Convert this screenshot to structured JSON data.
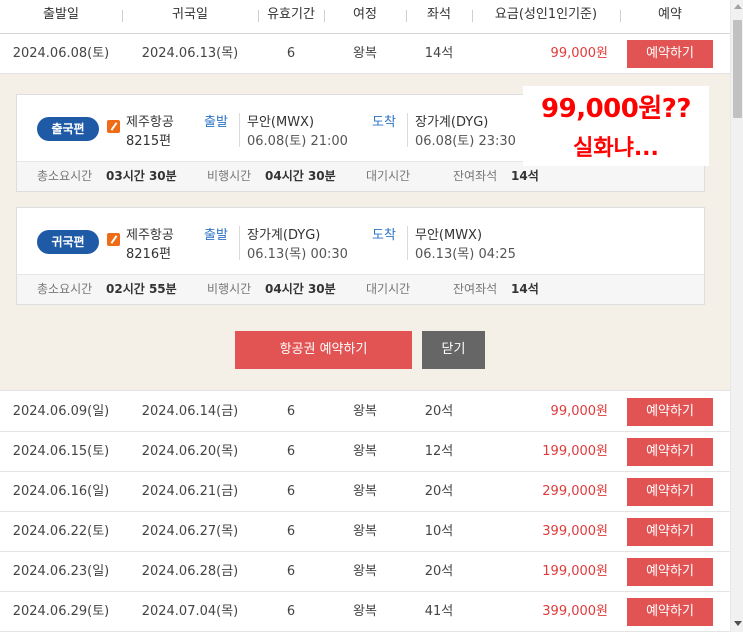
{
  "header": {
    "columns": [
      "출발일",
      "귀국일",
      "유효기간",
      "여정",
      "좌석",
      "요금(성인1인기준)",
      "예약"
    ]
  },
  "book_label": "예약하기",
  "selected_row": {
    "dep": "2024.06.08(토)",
    "ret": "2024.06.13(목)",
    "valid": "6",
    "trip": "왕복",
    "seats": "14석",
    "price": "99,000원"
  },
  "rows": [
    {
      "dep": "2024.06.09(일)",
      "ret": "2024.06.14(금)",
      "valid": "6",
      "trip": "왕복",
      "seats": "20석",
      "price": "99,000원"
    },
    {
      "dep": "2024.06.15(토)",
      "ret": "2024.06.20(목)",
      "valid": "6",
      "trip": "왕복",
      "seats": "12석",
      "price": "199,000원"
    },
    {
      "dep": "2024.06.16(일)",
      "ret": "2024.06.21(금)",
      "valid": "6",
      "trip": "왕복",
      "seats": "20석",
      "price": "299,000원"
    },
    {
      "dep": "2024.06.22(토)",
      "ret": "2024.06.27(목)",
      "valid": "6",
      "trip": "왕복",
      "seats": "10석",
      "price": "399,000원"
    },
    {
      "dep": "2024.06.23(일)",
      "ret": "2024.06.28(금)",
      "valid": "6",
      "trip": "왕복",
      "seats": "20석",
      "price": "199,000원"
    },
    {
      "dep": "2024.06.29(토)",
      "ret": "2024.07.04(목)",
      "valid": "6",
      "trip": "왕복",
      "seats": "41석",
      "price": "399,000원"
    }
  ],
  "detail": {
    "outbound": {
      "badge": "출국편",
      "airline": "제주항공",
      "flight_no": "8215편",
      "dep_label": "출발",
      "dep_place": "무안(MWX)",
      "dep_time": "06.08(토) 21:00",
      "arr_label": "도착",
      "arr_place": "장가계(DYG)",
      "arr_time": "06.08(토) 23:30",
      "total_label": "총소요시간",
      "total_value": "03시간 30분",
      "fly_label": "비행시간",
      "fly_value": "04시간 30분",
      "wait_label": "대기시간",
      "seats_label": "잔여좌석",
      "seats_value": "14석"
    },
    "inbound": {
      "badge": "귀국편",
      "airline": "제주항공",
      "flight_no": "8216편",
      "dep_label": "출발",
      "dep_place": "장가계(DYG)",
      "dep_time": "06.13(목) 00:30",
      "arr_label": "도착",
      "arr_place": "무안(MWX)",
      "arr_time": "06.13(목) 04:25",
      "total_label": "총소요시간",
      "total_value": "02시간 55분",
      "fly_label": "비행시간",
      "fly_value": "04시간 30분",
      "wait_label": "대기시간",
      "seats_label": "잔여좌석",
      "seats_value": "14석"
    },
    "book_ticket_label": "항공권 예약하기",
    "close_label": "닫기"
  },
  "overlay": {
    "line1": "99,000원??",
    "line2": "실화냐..."
  },
  "colors": {
    "accent_red": "#e25454",
    "price_red": "#e03b3b",
    "badge_blue": "#1f5aa6",
    "link_blue": "#2b73c4",
    "panel_bg": "#f4efe7",
    "airline_orange": "#ef6b15"
  },
  "icons": [
    "jeju-air-icon",
    "scroll-up-icon",
    "scroll-down-icon"
  ]
}
